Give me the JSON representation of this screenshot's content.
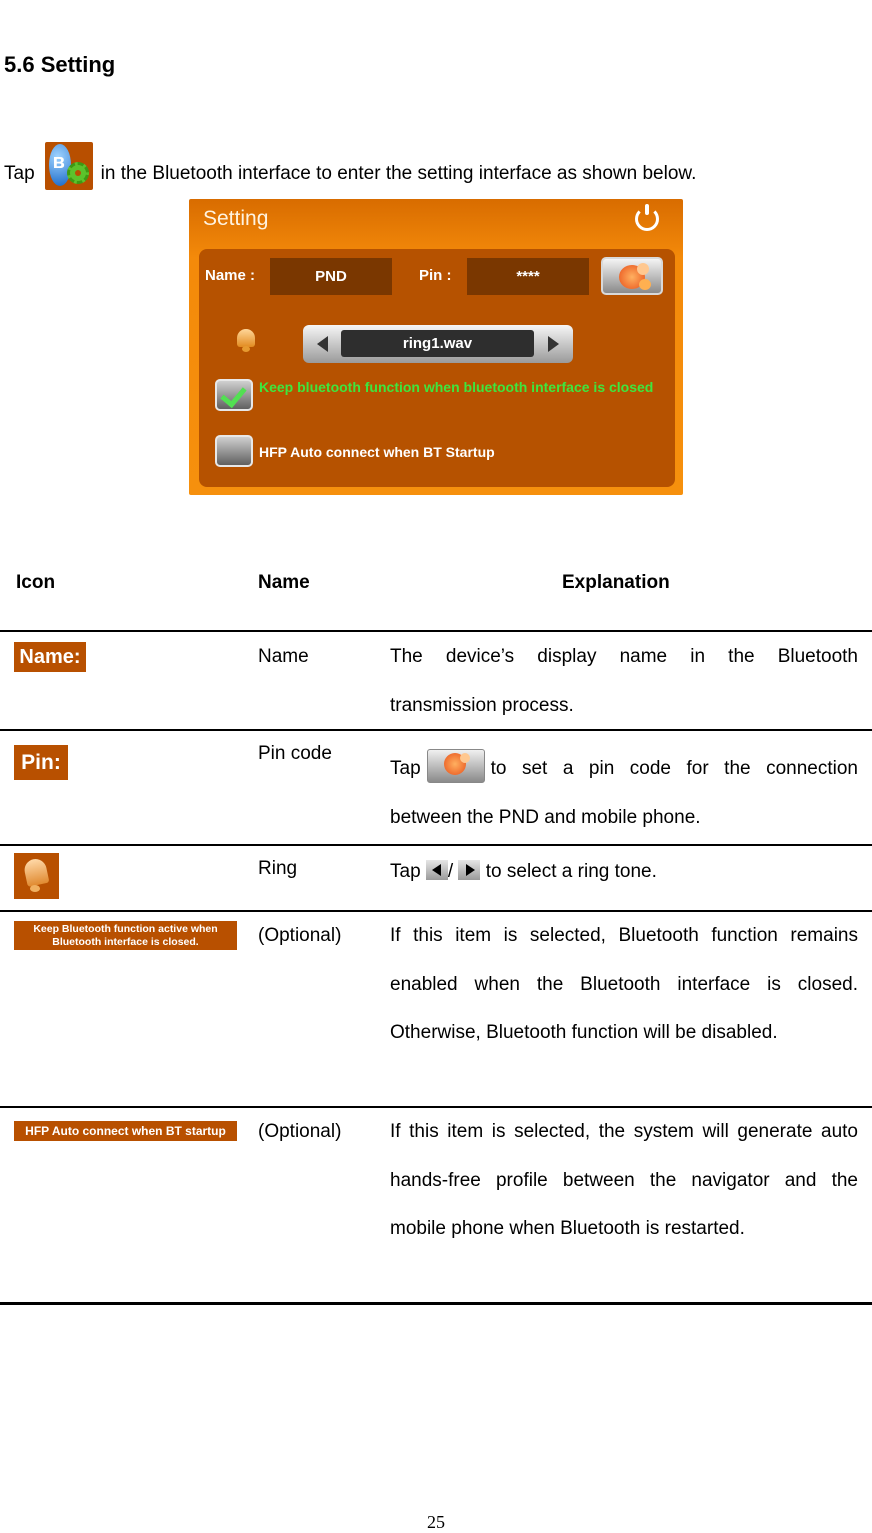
{
  "heading": "5.6 Setting",
  "intro": {
    "before": "Tap",
    "icon": "bluetooth-settings-icon",
    "after": "in the Bluetooth interface to enter the setting interface as shown below."
  },
  "device_screen": {
    "title": "Setting",
    "power_icon": "power-icon",
    "name_label": "Name :",
    "name_value": "PND",
    "pin_label": "Pin :",
    "pin_value": "****",
    "pin_button_icon": "gear-flower-icon",
    "ring_icon": "bell-icon",
    "ringtone_value": "ring1.wav",
    "options": [
      {
        "label": "Keep bluetooth function when bluetooth interface is closed",
        "checked": true,
        "color": "#3ee63e"
      },
      {
        "label": "HFP Auto connect when BT Startup",
        "checked": false,
        "color": "#ffffff"
      }
    ]
  },
  "table": {
    "headers": {
      "icon": "Icon",
      "name": "Name",
      "explanation": "Explanation"
    },
    "rows": [
      {
        "icon_text": "Name:",
        "name": "Name",
        "explanation": "The device’s display name in the Bluetooth transmission process."
      },
      {
        "icon_text": "Pin:",
        "name": "Pin code",
        "explanation_before": "Tap",
        "explanation_after": "to set a pin code for the connection between the PND and mobile phone."
      },
      {
        "icon_text": "",
        "name": "Ring",
        "explanation_before": "Tap",
        "explanation_sep": "/",
        "explanation_after": "to select a ring tone."
      },
      {
        "icon_text": "Keep Bluetooth function active when Bluetooth interface is closed.",
        "name": "(Optional)",
        "explanation": "If this item is selected, Bluetooth function remains enabled when the Bluetooth interface is closed. Otherwise, Bluetooth function will be disabled."
      },
      {
        "icon_text": "HFP Auto connect when BT startup",
        "name": "(Optional)",
        "explanation": "If this item is selected, the system will generate auto hands-free profile between the navigator and the mobile phone when Bluetooth is restarted."
      }
    ]
  },
  "page_number": "25"
}
